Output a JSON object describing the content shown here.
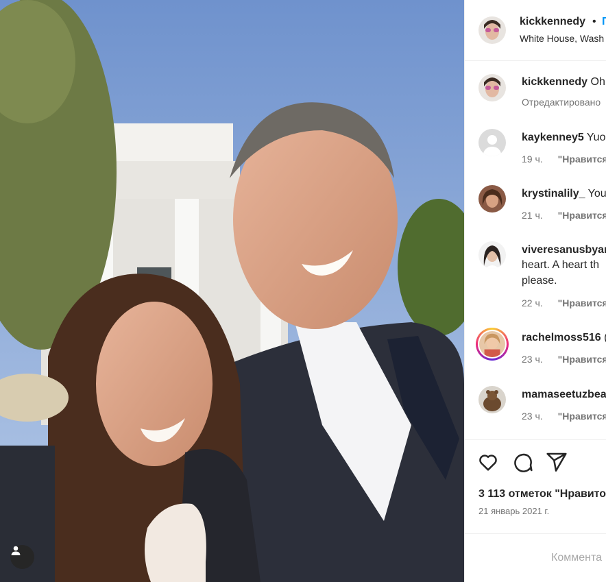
{
  "post": {
    "username": "kickkennedy",
    "separator": "•",
    "follow_label": "П",
    "location": "White House, Wash"
  },
  "caption": {
    "username": "kickkennedy",
    "text": "Oh",
    "meta": "Отредактировано"
  },
  "comments": [
    {
      "username": "kaykenney5",
      "text": "Yuo",
      "time": "19 ч.",
      "like_label": "\"Нравится\""
    },
    {
      "username": "krystinalily_",
      "text": "You",
      "time": "21 ч.",
      "like_label": "\"Нравится\""
    },
    {
      "username": "viveresanusbyar",
      "line2": "heart. A heart th",
      "line3": "please.",
      "time": "22 ч.",
      "like_label": "\"Нравится\""
    },
    {
      "username": "rachelmoss516",
      "text": "(",
      "time": "23 ч.",
      "like_label": "\"Нравится\""
    },
    {
      "username": "mamaseetuzbea",
      "time": "23 ч.",
      "like_label": "\"Нравится\""
    }
  ],
  "actions": {
    "like_icon": "heart-icon",
    "comment_icon": "comment-icon",
    "share_icon": "paper-plane-icon",
    "likes_text": "3 113 отметок \"Нравито",
    "date_text": "21 январь 2021 г."
  },
  "add_comment": {
    "placeholder": "Коммента"
  },
  "colors": {
    "link_blue": "#0095f6",
    "muted": "#737373",
    "border": "#efefef"
  }
}
